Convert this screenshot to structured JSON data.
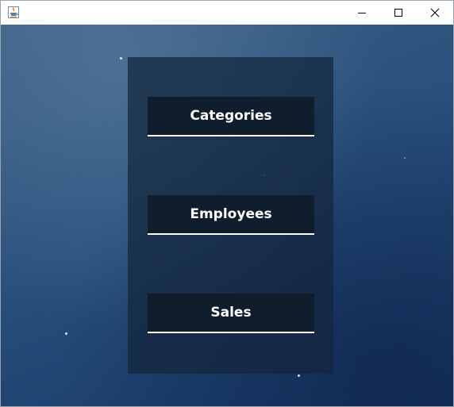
{
  "window": {
    "app_icon": "java-cup-icon",
    "controls": {
      "minimize": "minimize-icon",
      "maximize": "maximize-icon",
      "close": "close-icon"
    }
  },
  "menu": {
    "buttons": [
      {
        "label": "Categories"
      },
      {
        "label": "Employees"
      },
      {
        "label": "Sales"
      }
    ]
  },
  "colors": {
    "panel": "#14263c",
    "button_bg": "#0f1d2d",
    "button_text": "#ffffff",
    "button_underline": "#ffffff",
    "background_top": "#3c5f84",
    "background_bottom": "#183866"
  }
}
